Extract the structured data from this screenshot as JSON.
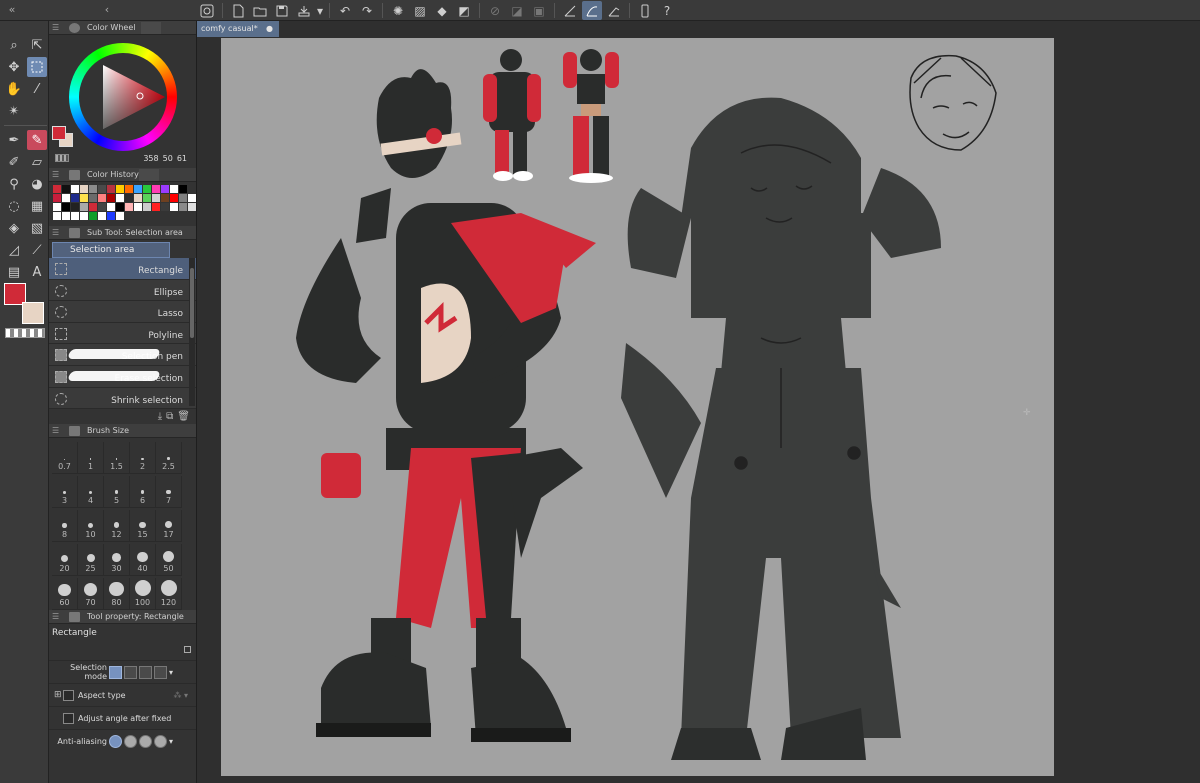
{
  "document": {
    "tab_title": "comfy casual*",
    "tab_close": "●"
  },
  "panels": {
    "color_wheel": {
      "title": "Color Wheel",
      "hsv": [
        "358",
        "50",
        "61"
      ]
    },
    "color_history": {
      "title": "Color History",
      "swatches": [
        "#d02a38",
        "#111111",
        "#ffffff",
        "#e7d4c4",
        "#8c8c8c",
        "#4a4a4a",
        "#b8323f",
        "#ffcc00",
        "#ff6a00",
        "#3aa3ff",
        "#28c83b",
        "#ff3cb4",
        "#9b3bff",
        "#ffffff",
        "#000000",
        "#333333",
        "#c81e3c",
        "#ffffff",
        "#1e2b8c",
        "#ffe14d",
        "#6b6b6b",
        "#ff8080",
        "#aa0000",
        "#ffffff",
        "#2c2c2c",
        "#e7d4c4",
        "#5ad25a",
        "#d2d2d2",
        "#6e4020",
        "#ff0000",
        "#7f7f7f",
        "#ffffff",
        "#ffffff",
        "#000000",
        "#222222",
        "#aaaaaa",
        "#d02a38",
        "#444444",
        "#ffffff",
        "#000000",
        "#ffb3b3",
        "#ffffff",
        "#cccccc",
        "#ff2020",
        "#3b3b3b",
        "#ffffff",
        "#8a8a8a",
        "#e0e0e0",
        "#ffffff",
        "#ffffff",
        "#ffffff",
        "#ffffff",
        "#0f9d2a",
        "#ffffff",
        "#1e3cff",
        "#ffffff"
      ]
    },
    "sub_tool": {
      "title": "Sub Tool: Selection area",
      "group": "Selection area",
      "items": [
        "Rectangle",
        "Ellipse",
        "Lasso",
        "Polyline",
        "Selection pen",
        "Erase selection",
        "Shrink selection"
      ]
    },
    "brush_size": {
      "title": "Brush Size",
      "sizes": [
        "0.7",
        "1",
        "1.5",
        "2",
        "2.5",
        "3",
        "4",
        "5",
        "6",
        "7",
        "8",
        "10",
        "12",
        "15",
        "17",
        "20",
        "25",
        "30",
        "40",
        "50",
        "60",
        "70",
        "80",
        "100",
        "120"
      ]
    },
    "tool_property": {
      "title": "Tool property: Rectangle",
      "name": "Rectangle",
      "selection_mode": "Selection mode",
      "aspect_type": "Aspect type",
      "adjust_angle": "Adjust angle after fixed",
      "anti_aliasing": "Anti-aliasing"
    }
  },
  "colors": {
    "main": "#d02a38",
    "sub": "#e7d4c4",
    "accent": "#5a6f8c",
    "canvas": "#a2a2a2"
  }
}
